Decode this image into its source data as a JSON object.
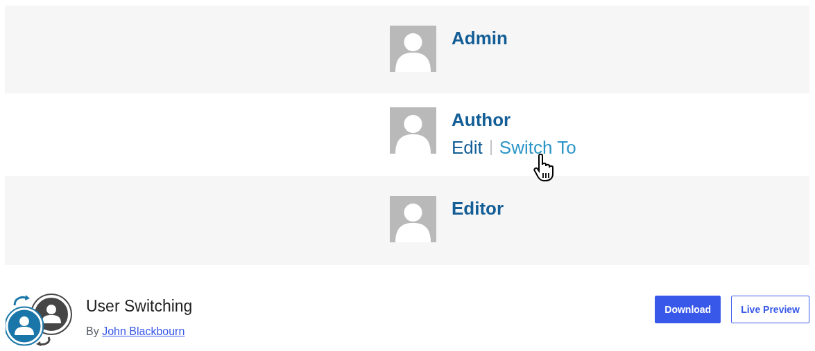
{
  "banner": {
    "users": [
      {
        "name": "Admin"
      },
      {
        "name": "Author",
        "actions": [
          {
            "label": "Edit",
            "kind": "edit"
          },
          {
            "label": "Switch To",
            "kind": "switch"
          }
        ]
      },
      {
        "name": "Editor"
      }
    ]
  },
  "plugin": {
    "title": "User Switching",
    "by": "By",
    "author": "John Blackbourn",
    "buttons": [
      {
        "label": "Download",
        "kind": "primary"
      },
      {
        "label": "Live Preview",
        "kind": "secondary"
      }
    ]
  }
}
